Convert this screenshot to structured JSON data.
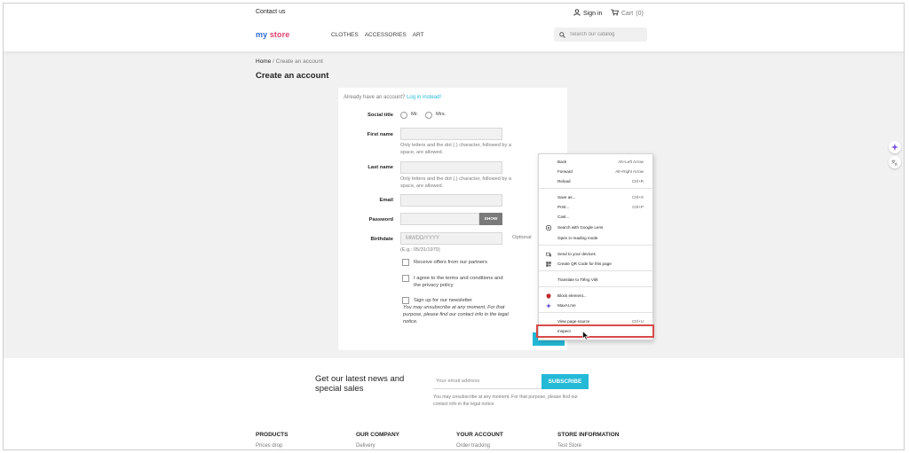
{
  "header": {
    "contact": "Contact us",
    "sign_in": "Sign in",
    "cart": "Cart",
    "cart_count": "(0)",
    "logo_part1": "my",
    "logo_part2": "store",
    "nav": [
      "CLOTHES",
      "ACCESSORIES",
      "ART"
    ],
    "search_placeholder": "Search our catalog"
  },
  "breadcrumb": {
    "home": "Home",
    "separator": "/",
    "current": "Create an account"
  },
  "page_title": "Create an account",
  "form": {
    "already_text": "Already have an account?",
    "login_link": "Log in instead!",
    "social_title_label": "Social title",
    "mr": "Mr.",
    "mrs": "Mrs.",
    "first_name_label": "First name",
    "first_name_hint": "Only letters and the dot (.) character, followed by a space, are allowed.",
    "last_name_label": "Last name",
    "last_name_hint": "Only letters and the dot (.) character, followed by a space, are allowed.",
    "email_label": "Email",
    "password_label": "Password",
    "show_button": "SHOW",
    "birthdate_label": "Birthdate",
    "birthdate_placeholder": "MM/DD/YYYY",
    "birthdate_example": "(E.g.: 05/31/1970)",
    "optional": "Optional",
    "offers": "Receive offers from our partners",
    "terms": "I agree to the terms and conditions and the privacy policy",
    "newsletter": "Sign up for our newsletter",
    "newsletter_note": "You may unsubscribe at any moment. For that purpose, please find our contact info in the legal notice."
  },
  "context_menu": {
    "items": [
      {
        "label": "Back",
        "shortcut": "Alt+Left Arrow"
      },
      {
        "label": "Forward",
        "shortcut": "Alt+Right Arrow"
      },
      {
        "label": "Reload",
        "shortcut": "Ctrl+R"
      },
      {
        "label": "Save as...",
        "shortcut": "Ctrl+S"
      },
      {
        "label": "Print...",
        "shortcut": "Ctrl+P"
      },
      {
        "label": "Cast..."
      },
      {
        "label": "Search with Google Lens",
        "icon": "lens-icon"
      },
      {
        "label": "Open in reading mode"
      },
      {
        "label": "Send to your devices",
        "icon": "devices-icon"
      },
      {
        "label": "Create QR Code for this page",
        "icon": "qr-icon"
      },
      {
        "label": "Translate to Tiếng Việt"
      },
      {
        "label": "Block element...",
        "icon": "shield-icon"
      },
      {
        "label": "MaxAI.me",
        "icon": "sparkle-icon"
      },
      {
        "label": "View page source",
        "shortcut": "Ctrl+U"
      },
      {
        "label": "Inspect"
      }
    ]
  },
  "newsletter_footer": {
    "title": "Get our latest news and special sales",
    "input_placeholder": "Your email address",
    "subscribe": "SUBSCRIBE",
    "note": "You may unsubscribe at any moment. For that purpose, please find our contact info in the legal notice."
  },
  "footer": {
    "columns": [
      {
        "heading": "PRODUCTS",
        "first_link": "Prices drop"
      },
      {
        "heading": "OUR COMPANY",
        "first_link": "Delivery"
      },
      {
        "heading": "YOUR ACCOUNT",
        "first_link": "Order tracking"
      },
      {
        "heading": "STORE INFORMATION",
        "first_link": "Test Store"
      }
    ]
  },
  "colors": {
    "accent": "#24b9d7",
    "highlight_box": "#d94a4a",
    "logo_blue": "#2f6bd8",
    "logo_pink": "#e2416f"
  }
}
